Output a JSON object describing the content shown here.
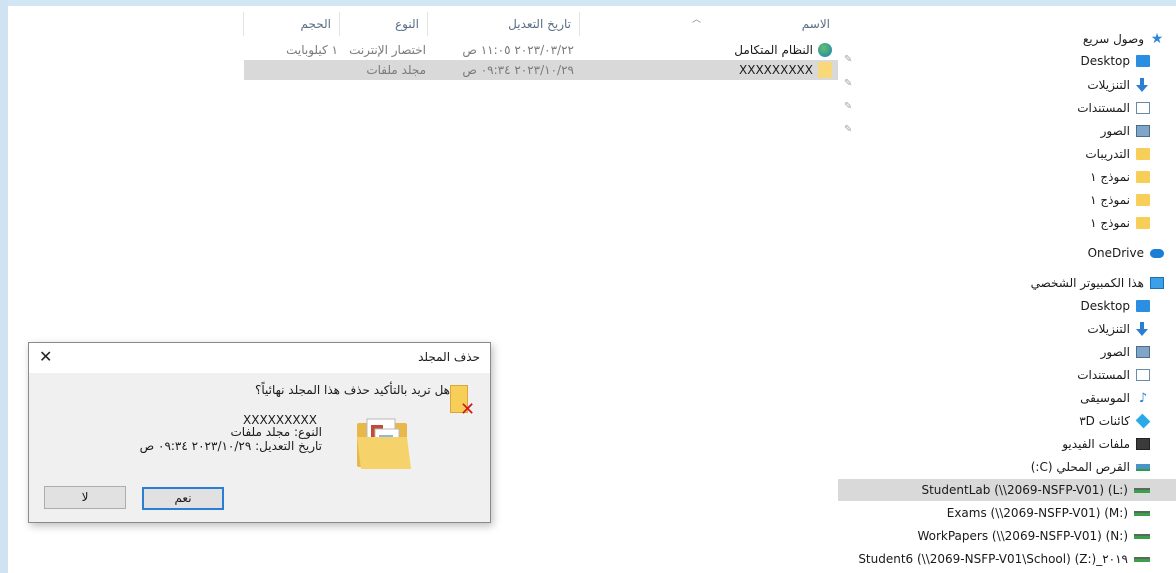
{
  "file_list": {
    "columns": {
      "name": "الاسم",
      "date": "تاريخ التعديل",
      "type": "النوع",
      "size": "الحجم"
    },
    "rows": [
      {
        "name": "النظام المتكامل",
        "date": "٢٠٢٣/٠٣/٢٢ ١١:٠٥ ص",
        "type": "اختصار الإنترنت",
        "size": "١ كيلوبايت",
        "icon": "internet-shortcut-icon"
      },
      {
        "name": "XXXXXXXXX",
        "date": "٢٠٢٣/١٠/٢٩ ٠٩:٣٤ ص",
        "type": "مجلد ملفات",
        "size": "",
        "icon": "folder-icon"
      }
    ]
  },
  "nav_pane": {
    "quick_access": "وصول سريع",
    "quick_items": [
      {
        "label": "Desktop",
        "icon": "desktop-icon",
        "pinned": true
      },
      {
        "label": "التنزيلات",
        "icon": "downloads-icon",
        "pinned": true
      },
      {
        "label": "المستندات",
        "icon": "documents-icon",
        "pinned": true
      },
      {
        "label": "الصور",
        "icon": "pictures-icon",
        "pinned": true
      },
      {
        "label": "التدريبات",
        "icon": "folder-icon",
        "pinned": false
      },
      {
        "label": "نموذج ١",
        "icon": "folder-icon",
        "pinned": false
      },
      {
        "label": "نموذج ١",
        "icon": "folder-icon",
        "pinned": false
      },
      {
        "label": "نموذج ١",
        "icon": "folder-icon",
        "pinned": false
      }
    ],
    "onedrive": "OneDrive",
    "this_pc": "هذا الكمبيوتر الشخصي",
    "pc_items": [
      {
        "label": "Desktop",
        "icon": "desktop-icon"
      },
      {
        "label": "التنزيلات",
        "icon": "downloads-icon"
      },
      {
        "label": "الصور",
        "icon": "pictures-icon"
      },
      {
        "label": "المستندات",
        "icon": "documents-icon"
      },
      {
        "label": "الموسيقى",
        "icon": "music-icon"
      },
      {
        "label": "كائنات ٣D",
        "icon": "3d-objects-icon"
      },
      {
        "label": "ملفات الفيديو",
        "icon": "videos-icon"
      },
      {
        "label": "القرص المحلي (C:)",
        "icon": "local-disk-icon"
      }
    ],
    "network_drives": [
      {
        "label": "StudentLab (\\\\2069-NSFP-V01) (L:)",
        "selected": true
      },
      {
        "label": "Exams (\\\\2069-NSFP-V01) (M:)",
        "selected": false
      },
      {
        "label": "WorkPapers (\\\\2069-NSFP-V01) (N:)",
        "selected": false
      },
      {
        "label": "Student6 (\\\\2069-NSFP-V01\\School) (Z:)_٢٠١٩",
        "selected": false
      }
    ]
  },
  "dialog": {
    "title": "حذف المجلد",
    "close": "✕",
    "question": "هل تريد بالتأكيد حذف هذا المجلد نهائياً؟",
    "folder_name": "XXXXXXXXX",
    "type_line": "النوع: مجلد ملفات",
    "date_line": "تاريخ التعديل: ٢٠٢٣/١٠/٢٩ ٠٩:٣٤ ص",
    "yes_label": "نعم",
    "no_label": "لا"
  }
}
